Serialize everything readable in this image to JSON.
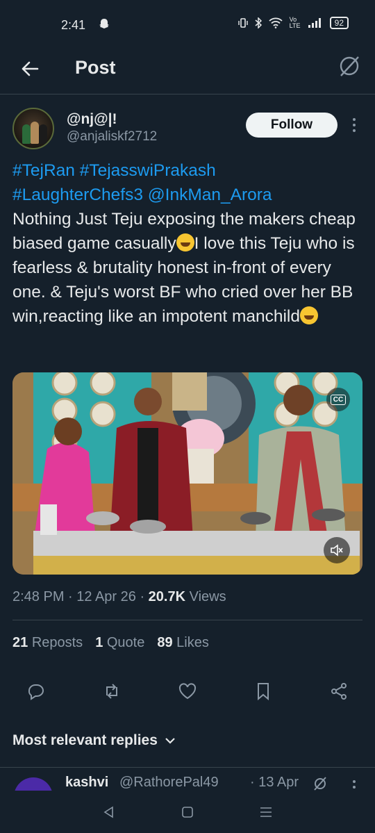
{
  "status": {
    "time": "2:41",
    "network": "Vo LTE",
    "battery": "92"
  },
  "header": {
    "title": "Post"
  },
  "author": {
    "name": "@nj@|!",
    "handle": "@anjaliskf2712",
    "follow_label": "Follow"
  },
  "post": {
    "hashtags": [
      "#TejRan",
      "#TejasswiPrakash",
      "#LaughterChefs3"
    ],
    "mention": "@InkMan_Arora",
    "text_1": "Nothing Just Teju exposing the  makers cheap biased game casually",
    "text_2": "I love this Teju who is fearless & brutality honest in-front of every one. & Teju's worst BF who cried over her BB win,reacting like an impotent manchild",
    "cc_label": "CC"
  },
  "meta": {
    "time": "2:48 PM",
    "date": "12 Apr 26",
    "views_count": "20.7K",
    "views_label": "Views"
  },
  "stats": {
    "reposts_count": "21",
    "reposts_label": "Reposts",
    "quotes_count": "1",
    "quotes_label": "Quote",
    "likes_count": "89",
    "likes_label": "Likes"
  },
  "actions": [
    "reply-icon",
    "repost-icon",
    "like-icon",
    "bookmark-icon",
    "share-icon"
  ],
  "replies": {
    "header": "Most relevant replies",
    "first": {
      "name": "kashvi",
      "handle": "@RathorePal49",
      "date": "· 13 Apr"
    }
  },
  "colors": {
    "background": "#15202b",
    "accent": "#1d9bf0",
    "muted": "#8b98a5",
    "text": "#e7e9ea"
  }
}
